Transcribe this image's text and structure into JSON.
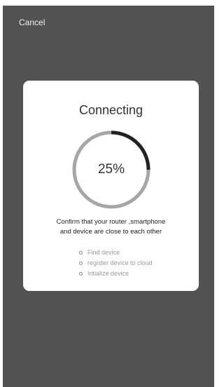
{
  "header": {
    "cancel_label": "Cancel"
  },
  "dialog": {
    "title": "Connecting",
    "progress": {
      "percent_label": "25%",
      "value": 0.25,
      "colors": {
        "track": "#a6a6a6",
        "fill": "#222222"
      }
    },
    "message_line1": "Confirm that your router ,smartphone",
    "message_line2": "and device are close to each other",
    "steps": [
      {
        "label": "Find device"
      },
      {
        "label": "register device to cloud"
      },
      {
        "label": "Intialize device"
      }
    ]
  },
  "colors": {
    "background": "#525252",
    "card": "#ffffff"
  }
}
